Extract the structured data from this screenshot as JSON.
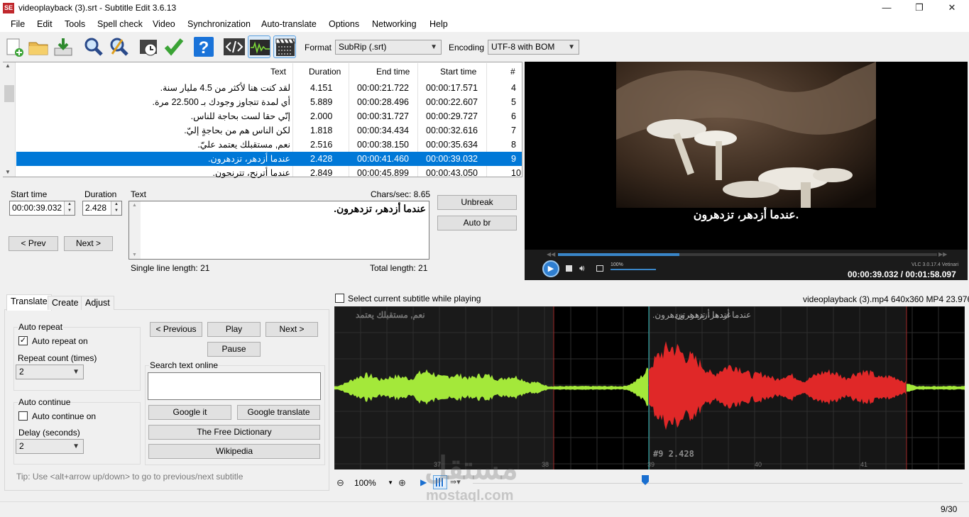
{
  "window": {
    "title": "videoplayback (3).srt - Subtitle Edit 3.6.13",
    "minimize": "—",
    "maximize": "❐",
    "close": "✕"
  },
  "menu": [
    "File",
    "Edit",
    "Tools",
    "Spell check",
    "Video",
    "Synchronization",
    "Auto-translate",
    "Options",
    "Networking",
    "Help"
  ],
  "toolbar": {
    "format_label": "Format",
    "format_value": "SubRip (.srt)",
    "encoding_label": "Encoding",
    "encoding_value": "UTF-8 with BOM"
  },
  "grid": {
    "headers": {
      "text": "Text",
      "duration": "Duration",
      "end": "End time",
      "start": "Start time",
      "num": "#"
    },
    "rows": [
      {
        "num": "4",
        "start": "00:00:17.571",
        "end": "00:00:21.722",
        "duration": "4.151",
        "text": "لقد كنت هنا لأكثر من 4.5 مليار سنة."
      },
      {
        "num": "5",
        "start": "00:00:22.607",
        "end": "00:00:28.496",
        "duration": "5.889",
        "text": "أي لمدة تتجاوز وجودك بـ  22.500 مرة."
      },
      {
        "num": "6",
        "start": "00:00:29.727",
        "end": "00:00:31.727",
        "duration": "2.000",
        "text": "إنّي حقا لست بحاجة للناس."
      },
      {
        "num": "7",
        "start": "00:00:32.616",
        "end": "00:00:34.434",
        "duration": "1.818",
        "text": "لكن الناس هم من بحاجةٍ إليّ."
      },
      {
        "num": "8",
        "start": "00:00:35.634",
        "end": "00:00:38.150",
        "duration": "2.516",
        "text": "نعم, مستقبلك يعتمد عليّ."
      },
      {
        "num": "9",
        "start": "00:00:39.032",
        "end": "00:00:41.460",
        "duration": "2.428",
        "text": "عندما أزدهر، تزدهرون."
      },
      {
        "num": "10",
        "start": "00:00:43.050",
        "end": "00:00:45.899",
        "duration": "2.849",
        "text": "عندما أترنح، تترنحون."
      }
    ]
  },
  "editor": {
    "start_label": "Start time",
    "start_value": "00:00:39.032",
    "duration_label": "Duration",
    "duration_value": "2.428",
    "text_label": "Text",
    "chars_sec": "Chars/sec: 8.65",
    "text_value": "عندما أزدهر، تزدهرون.",
    "prev": "< Prev",
    "next": "Next >",
    "unbreak": "Unbreak",
    "auto_br": "Auto br",
    "single_line": "Single line length: 21",
    "total_length": "Total length: 21"
  },
  "video": {
    "subtitle": "عندما أزدهر، تزدهرون.",
    "version": "VLC 3.0.17.4 Vetinari",
    "volume": "100%",
    "time": "00:00:39.032 / 00:01:58.097"
  },
  "tabs": [
    "Translate",
    "Create",
    "Adjust"
  ],
  "translate": {
    "auto_repeat_group": "Auto repeat",
    "auto_repeat_on": "Auto repeat on",
    "repeat_count_label": "Repeat count (times)",
    "repeat_count": "2",
    "auto_continue_group": "Auto continue",
    "auto_continue_on": "Auto continue on",
    "delay_label": "Delay (seconds)",
    "delay": "2",
    "previous": "< Previous",
    "play": "Play",
    "next": "Next >",
    "pause": "Pause",
    "search_group": "Search text online",
    "google_it": "Google it",
    "google_translate": "Google translate",
    "free_dictionary": "The Free Dictionary",
    "wikipedia": "Wikipedia",
    "tip": "Tip: Use <alt+arrow up/down> to go to previous/next subtitle"
  },
  "waveform": {
    "select_current": "Select current subtitle while playing",
    "video_info": "videoplayback (3).mp4 640x360 MP4 23.976",
    "label_left": "نعم, مستقبلك يعتمد",
    "label_sel_1": "عندما أزدهر، تزدهرون.",
    "label_sel_2": "عندما أزدهر، تزدهرون.",
    "sel_info": "#9  2.428",
    "ticks": [
      "37",
      "38",
      "39",
      "40",
      "41"
    ],
    "zoom": "100%"
  },
  "watermark": {
    "arabic": "مستقل",
    "latin": "mostaql.com"
  },
  "status": {
    "position": "9/30"
  },
  "colors": {
    "selection": "#0078d7",
    "wave_normal": "#a4e83a",
    "wave_selected": "#e02828"
  }
}
